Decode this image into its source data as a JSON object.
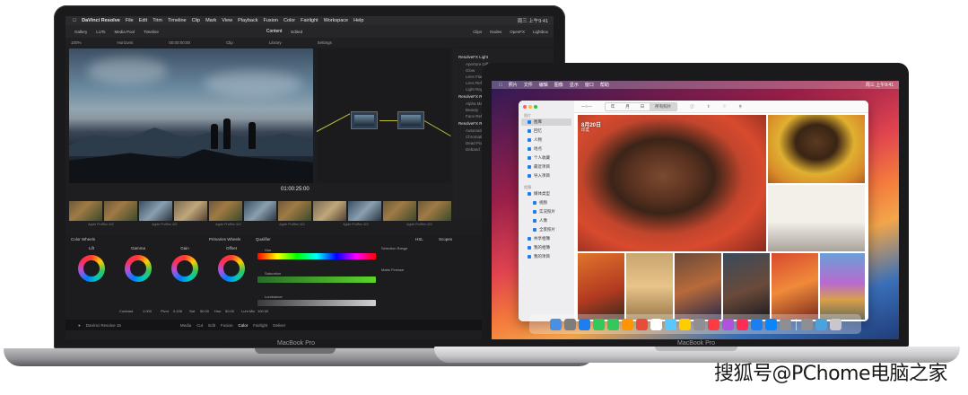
{
  "large_laptop": {
    "model_label": "MacBook Pro",
    "menubar": {
      "app_name": "DaVinci Resolve",
      "menus": [
        "File",
        "Edit",
        "Trim",
        "Timeline",
        "Clip",
        "Mark",
        "View",
        "Playback",
        "Fusion",
        "Color",
        "Fairlight",
        "Workspace",
        "Help"
      ],
      "clock": "周三 上午9:41"
    },
    "toolbar": {
      "left_items": [
        "Gallery",
        "LUTs",
        "Media Pool",
        "Timeline"
      ],
      "center_title": "Content",
      "center_sub": "Edited",
      "right_items": [
        "Clips",
        "Nodes",
        "OpenFX",
        "Lightbox"
      ]
    },
    "subbar": {
      "zoom": "100%",
      "viewer_label": "Horizons",
      "timecode_top": "00:00:00:00",
      "clip_menu": "Clip",
      "library_tab": "Library",
      "settings_tab": "Settings"
    },
    "viewer_timecode": "01:00:25:00",
    "fx_panel": {
      "groups": [
        {
          "title": "ResolveFX Light",
          "items": [
            "Aperture Diffr.",
            "Glow",
            "Lens Flare",
            "Lens Reflec.",
            "Light Rays"
          ]
        },
        {
          "title": "ResolveFX Refine",
          "items": [
            "Alpha Matte",
            "Beauty",
            "Face Refine"
          ]
        },
        {
          "title": "ResolveFX Revival",
          "items": [
            "Automatic",
            "Chromatic",
            "Dead Pixel",
            "Deband"
          ]
        }
      ]
    },
    "clip_caption": "Apple ProRes 422",
    "color_page": {
      "wheels_title": "Color Wheels",
      "primaries_title": "Primaries Wheels",
      "wheels": [
        "Lift",
        "Gamma",
        "Gain",
        "Offset"
      ],
      "qualifier_title": "Qualifier",
      "hsl_label": "HSL",
      "scopes_label": "Scopes",
      "selection_range": "Selection Range",
      "matte_finesse": "Matte Finesse",
      "qualifier_rows": [
        "Hue",
        "Saturation",
        "Luminance"
      ],
      "contrast_label": "Contrast",
      "contrast_value": "1.000",
      "pivot_label": "Pivot",
      "pivot_value": "0.435",
      "sat_label": "Sat",
      "sat_value": "50.00",
      "hue_label": "Hue",
      "hue_value": "50.00",
      "lum_label": "Lum Mix",
      "lum_value": "100.00",
      "footer_app": "DaVinci Resolve 16",
      "pages": [
        "Media",
        "Cut",
        "Edit",
        "Fusion",
        "Color",
        "Fairlight",
        "Deliver"
      ]
    }
  },
  "small_laptop": {
    "model_label": "MacBook Pro",
    "menubar": {
      "items": [
        "照片",
        "文件",
        "编辑",
        "图像",
        "显示",
        "窗口",
        "帮助"
      ],
      "clock": "周三 上午9:41"
    },
    "photos_app": {
      "sidebar_group_library": "照片",
      "sidebar_items": [
        "图库",
        "回忆",
        "人物",
        "地点",
        "个人收藏",
        "最近项目",
        "导入项目"
      ],
      "sidebar_group_albums": "相簿",
      "album_items": [
        "媒体类型",
        "视频",
        "实况照片",
        "人像",
        "全景照片",
        "共享相簿",
        "我的相簿",
        "我的项目"
      ],
      "toolbar_segments": [
        "年",
        "月",
        "日",
        "所有照片"
      ],
      "selected_segment": "所有照片",
      "date_heading": "8月20日",
      "date_sub": "印度"
    },
    "dock_colors": [
      "#4a90e2",
      "#7d7d7d",
      "#1c7ef0",
      "#34c759",
      "#34c759",
      "#ff9500",
      "#e94d3a",
      "#ffffff",
      "#5ac8fa",
      "#ffcc00",
      "#8e8e93",
      "#fc3c44",
      "#af52de",
      "#ff2d55",
      "#1c7ef0",
      "#0a84ff",
      "#8e8e93",
      "#8e8e93",
      "#4aa3df",
      "#c7c7cc"
    ]
  },
  "watermark": "搜狐号@PChome电脑之家"
}
